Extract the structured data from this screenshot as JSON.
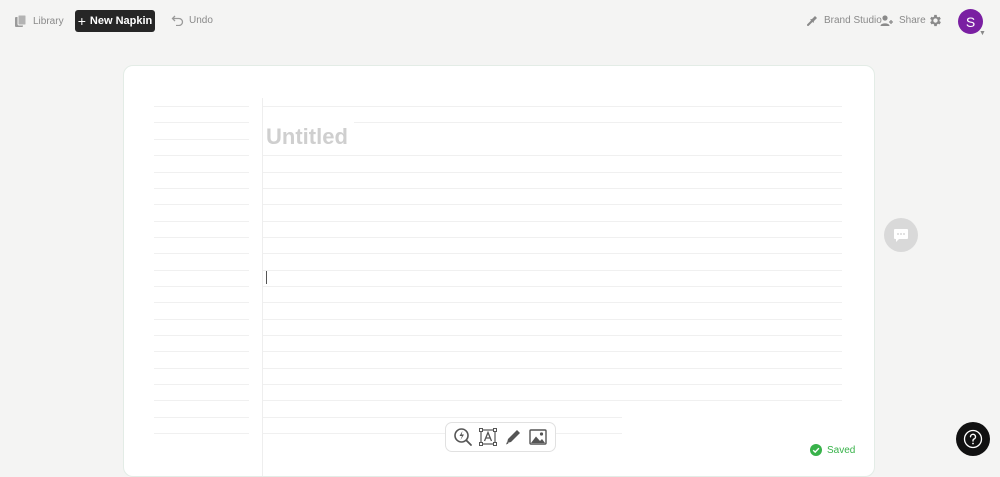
{
  "topbar": {
    "library_label": "Library",
    "new_napkin_label": "New Napkin",
    "undo_label": "Undo",
    "brand_studio_label": "Brand Studio",
    "share_label": "Share",
    "avatar_initial": "S"
  },
  "document": {
    "title_placeholder": "Untitled"
  },
  "status": {
    "saved_label": "Saved"
  },
  "icons": [
    "library-icon",
    "plus-icon",
    "undo-icon",
    "brand-studio-icon",
    "share-icon",
    "gear-icon",
    "chat-icon",
    "spark-search-icon",
    "text-box-icon",
    "pen-icon",
    "image-icon",
    "check-circle-icon",
    "help-icon"
  ],
  "colors": {
    "avatar": "#7a1fa2",
    "primary_button": "#262626",
    "saved": "#38b24a",
    "background": "#f4f4f3"
  }
}
